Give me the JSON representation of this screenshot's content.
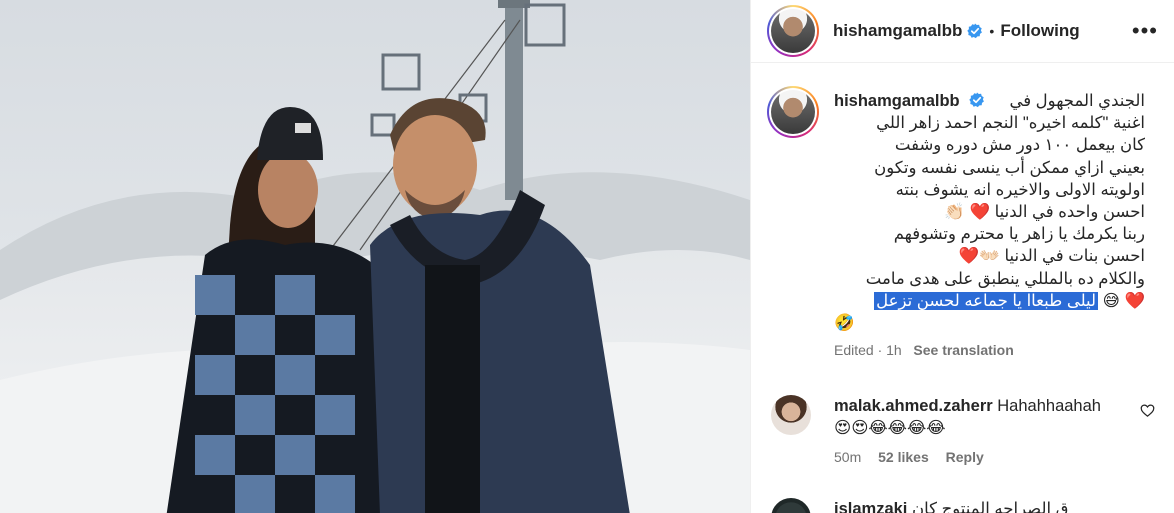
{
  "post": {
    "username": "hishamgamalbb",
    "follow_label": "Following",
    "separator": "•",
    "more_glyph": "•••"
  },
  "caption": {
    "username": "hishamgamalbb",
    "first_line": "الجندي المجهول في",
    "lines": [
      "اغنية \"كلمه اخيره\" النجم احمد زاهر اللي",
      "كان بيعمل ١٠٠ دور مش دوره وشفت",
      "بعيني ازاي ممكن أب ينسى نفسه وتكون",
      "اولويته الاولى والاخيره انه يشوف بنته",
      "احسن واحده في الدنيا ❤️ 👏🏻",
      "ربنا يكرمك يا زاهر يا محترم وتشوفهم",
      "احسن بنات في الدنيا 👐🏻❤️",
      "والكلام ده بالمللي ينطبق على هدى مامت"
    ],
    "highlighted": "ليلى طبعاا يا جماعه لحسن تزعل",
    "highlight_emoji": "❤️ 😅",
    "last_emoji": "🤣",
    "edited": "Edited · 1h",
    "see_translation": "See translation"
  },
  "comments": [
    {
      "username": "malak.ahmed.zaherr",
      "text": "Hahahhaahah",
      "emoji": "😍😍😂😂😂😂",
      "time": "50m",
      "likes": "52 likes",
      "reply": "Reply"
    },
    {
      "username": "islamzaki",
      "text": "ق الصراحه المنتوج كان"
    }
  ],
  "colors": {
    "accent_blue": "#0095f6",
    "verified_blue": "#3897f0",
    "highlight": "#2b6bd6",
    "secondary_text": "#737373"
  },
  "icons": {
    "verified": "verified-badge-icon",
    "more": "more-options-icon",
    "like": "heart-outline-icon"
  }
}
